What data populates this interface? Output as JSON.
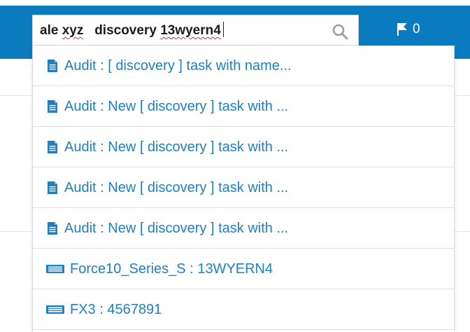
{
  "search": {
    "query_part1": "ale",
    "query_part2": "xyz",
    "query_part3": "discovery",
    "query_part4": "13wyern4",
    "search_icon": "search-icon"
  },
  "flags": {
    "icon": "flag-icon",
    "count": "0"
  },
  "dropdown": {
    "items": [
      {
        "icon": "document-icon",
        "label": "Audit : [ discovery ] task with name...",
        "color": "#1f80c1"
      },
      {
        "icon": "document-icon",
        "label": "Audit : New [ discovery ] task with ...",
        "color": "#1f80c1"
      },
      {
        "icon": "document-icon",
        "label": "Audit : New [ discovery ] task with ...",
        "color": "#1f80c1"
      },
      {
        "icon": "document-icon",
        "label": "Audit : New [ discovery ] task with ...",
        "color": "#1f80c1"
      },
      {
        "icon": "document-icon",
        "label": "Audit : New [ discovery ] task with ...",
        "color": "#1f80c1"
      },
      {
        "icon": "network-switch-icon",
        "label": "Force10_Series_S : 13WYERN4",
        "color": "#1f80c1"
      },
      {
        "icon": "network-switch-icon",
        "label": "FX3 : 4567891",
        "color": "#1f80c1"
      }
    ]
  },
  "colors": {
    "header_blue": "#0a7bbf",
    "link_blue": "#1f80c1",
    "divider": "#dcdfe3"
  }
}
